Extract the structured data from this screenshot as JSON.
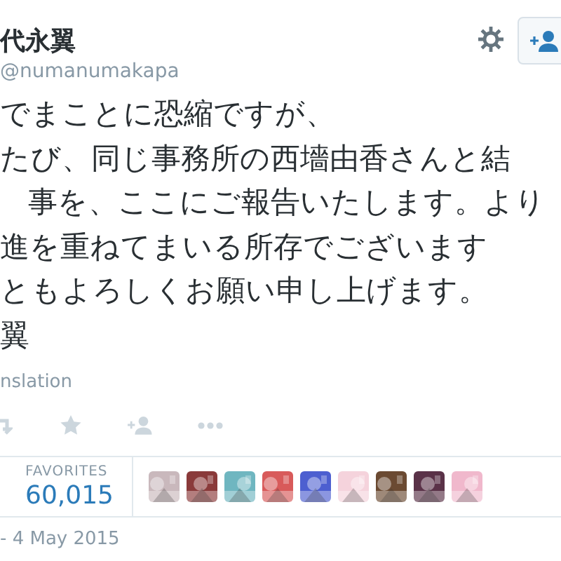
{
  "author": {
    "name": "代永翼",
    "handle": "@numanumakapa"
  },
  "tweet_lines": [
    "でまことに恐縮ですが、",
    "たび、同じ事務所の西墻由香さんと結",
    "事を、ここにご報告いたします。より",
    "進を重ねてまいる所存でございます",
    "ともよろしくお願い申し上げます。",
    "翼"
  ],
  "translation_link": "nslation",
  "stats": {
    "label": "FAVORITES",
    "value": "60,015"
  },
  "date": "- 4 May 2015"
}
